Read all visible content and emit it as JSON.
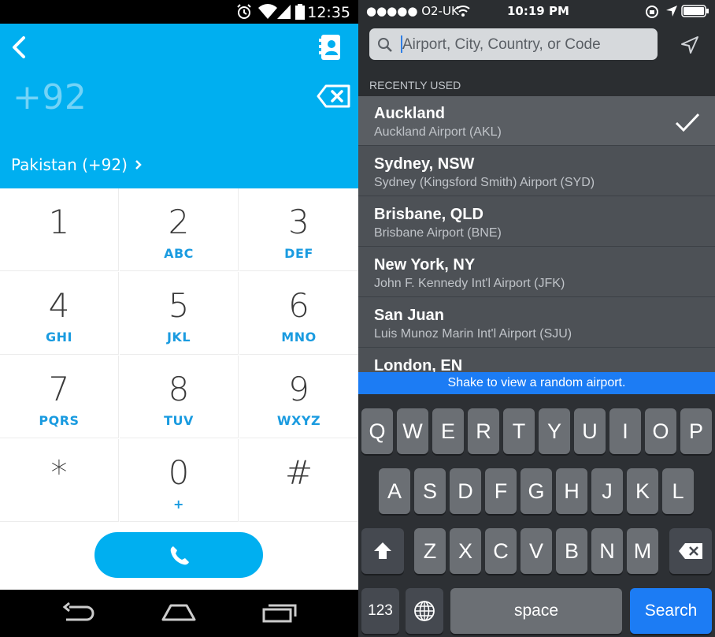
{
  "android": {
    "status_time": "12:35",
    "dialed_number": "+92",
    "country_label": "Pakistan (+92)",
    "country_chevron": "›",
    "keys": [
      {
        "digit": "1",
        "letters": ""
      },
      {
        "digit": "2",
        "letters": "ABC"
      },
      {
        "digit": "3",
        "letters": "DEF"
      },
      {
        "digit": "4",
        "letters": "GHI"
      },
      {
        "digit": "5",
        "letters": "JKL"
      },
      {
        "digit": "6",
        "letters": "MNO"
      },
      {
        "digit": "7",
        "letters": "PQRS"
      },
      {
        "digit": "8",
        "letters": "TUV"
      },
      {
        "digit": "9",
        "letters": "WXYZ"
      },
      {
        "digit": "*",
        "letters": ""
      },
      {
        "digit": "0",
        "letters": "+"
      },
      {
        "digit": "#",
        "letters": ""
      }
    ],
    "accent_color": "#00aff0",
    "icons": [
      "alarm-icon",
      "wifi-icon",
      "signal-icon",
      "battery-icon",
      "back-arrow-icon",
      "contacts-icon",
      "backspace-icon",
      "phone-icon",
      "nav-back-icon",
      "nav-home-icon",
      "nav-recents-icon"
    ]
  },
  "ios": {
    "status": {
      "carrier": "●●●●● O2-UK",
      "time": "10:19 PM"
    },
    "search_placeholder": "Airport, City, Country, or Code",
    "section_header": "RECENTLY USED",
    "airports": [
      {
        "city": "Auckland",
        "airport": "Auckland Airport (AKL)",
        "selected": true
      },
      {
        "city": "Sydney, NSW",
        "airport": "Sydney (Kingsford Smith) Airport (SYD)"
      },
      {
        "city": "Brisbane, QLD",
        "airport": "Brisbane Airport (BNE)"
      },
      {
        "city": "New York, NY",
        "airport": "John F. Kennedy Int'l Airport (JFK)"
      },
      {
        "city": "San Juan",
        "airport": "Luis Munoz Marin Int'l Airport (SJU)"
      },
      {
        "city": "London, EN",
        "airport": ""
      }
    ],
    "shake_banner": "Shake to view a random airport.",
    "keyboard": {
      "row1": [
        "Q",
        "W",
        "E",
        "R",
        "T",
        "Y",
        "U",
        "I",
        "O",
        "P"
      ],
      "row2": [
        "A",
        "S",
        "D",
        "F",
        "G",
        "H",
        "J",
        "K",
        "L"
      ],
      "row3": [
        "Z",
        "X",
        "C",
        "V",
        "B",
        "N",
        "M"
      ],
      "num_label": "123",
      "space_label": "space",
      "search_label": "Search"
    },
    "accent_color": "#1c7cf4",
    "icons": [
      "search-icon",
      "location-arrow-icon",
      "checkmark-icon",
      "shift-icon",
      "delete-icon",
      "globe-icon",
      "wifi-icon",
      "battery-icon"
    ]
  }
}
